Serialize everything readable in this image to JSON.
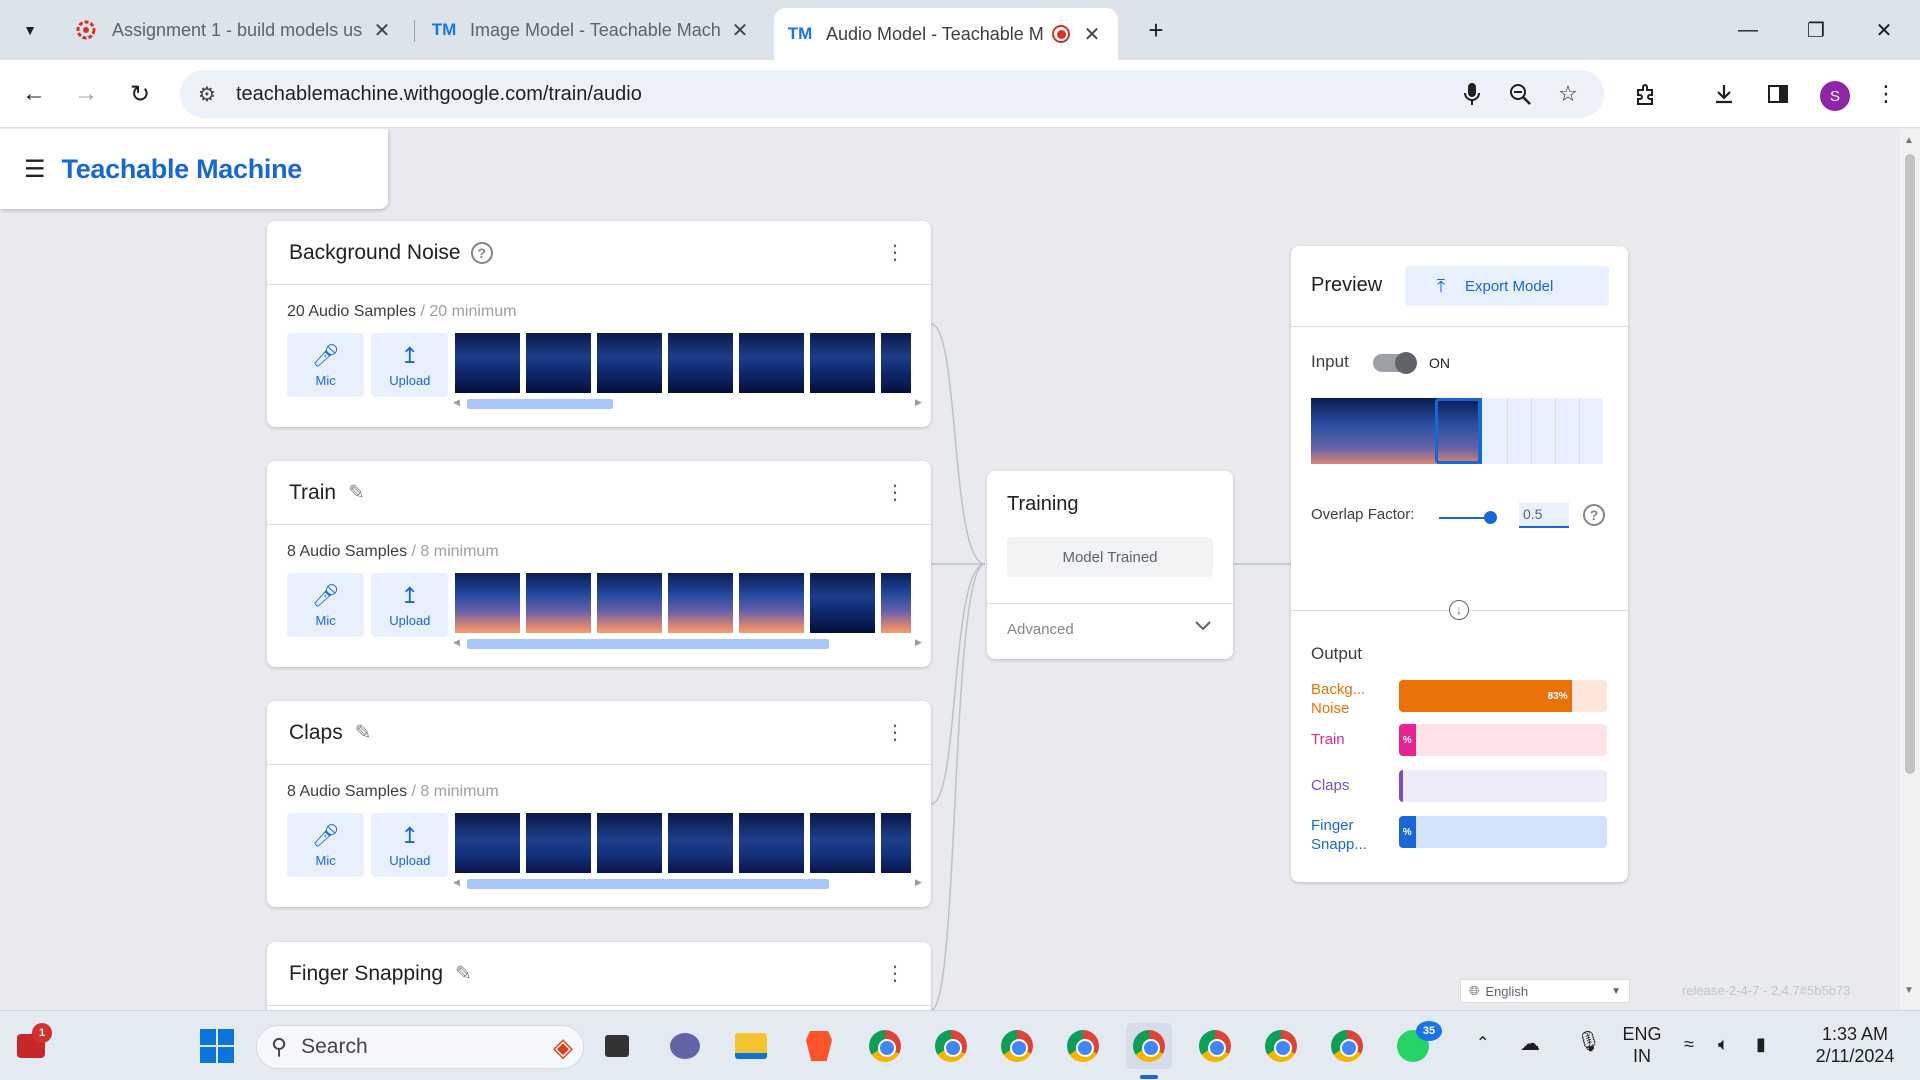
{
  "browser": {
    "tabs": [
      {
        "title": "Assignment 1 - build models us",
        "icon": "gear-logo-icon"
      },
      {
        "title": "Image Model - Teachable Mach",
        "icon": "tm-icon"
      },
      {
        "title": "Audio Model - Teachable M",
        "icon": "tm-icon",
        "active": true,
        "recording": true
      }
    ],
    "favicon_tm": "TM",
    "address": "teachablemachine.withgoogle.com/train/audio",
    "profile_initial": "S"
  },
  "app": {
    "brand": "Teachable Machine"
  },
  "classes": [
    {
      "name": "Background Noise",
      "count": "20 Audio Samples",
      "minimum": "/ 20 minimum",
      "mic": "Mic",
      "upload": "Upload"
    },
    {
      "name": "Train",
      "count": "8 Audio Samples",
      "minimum": "/ 8 minimum",
      "mic": "Mic",
      "upload": "Upload"
    },
    {
      "name": "Claps",
      "count": "8 Audio Samples",
      "minimum": "/ 8 minimum",
      "mic": "Mic",
      "upload": "Upload"
    },
    {
      "name": "Finger Snapping"
    }
  ],
  "training": {
    "title": "Training",
    "button": "Model Trained",
    "advanced": "Advanced"
  },
  "preview": {
    "title": "Preview",
    "export": "Export Model",
    "input_label": "Input",
    "input_state": "ON",
    "overlap_label": "Overlap Factor:",
    "overlap_value": "0.5",
    "output_title": "Output",
    "outputs": [
      {
        "label_1": "Backg...",
        "label_2": "Noise",
        "value": 0.83,
        "text": "83%",
        "color": "#e8710a",
        "bg": "#fde6d8"
      },
      {
        "label_1": "Train",
        "label_2": "",
        "value": 0.08,
        "text": "%",
        "color": "#e52592",
        "bg": "#fde3e6"
      },
      {
        "label_1": "Claps",
        "label_2": "",
        "value": 0.01,
        "text": "",
        "color": "#7b4cc4",
        "bg": "#efebfa"
      },
      {
        "label_1": "Finger",
        "label_2": "Snapp...",
        "value": 0.08,
        "text": "%",
        "color": "#1967d2",
        "bg": "#d2e3fc"
      }
    ]
  },
  "footer": {
    "language": "English",
    "release": "release-2-4-7 - 2.4.7#5b5b73"
  },
  "taskbar": {
    "search_placeholder": "Search",
    "notification_count": "1",
    "whatsapp_count": "35",
    "lang_top": "ENG",
    "lang_bottom": "IN",
    "time": "1:33 AM",
    "date": "2/11/2024"
  }
}
